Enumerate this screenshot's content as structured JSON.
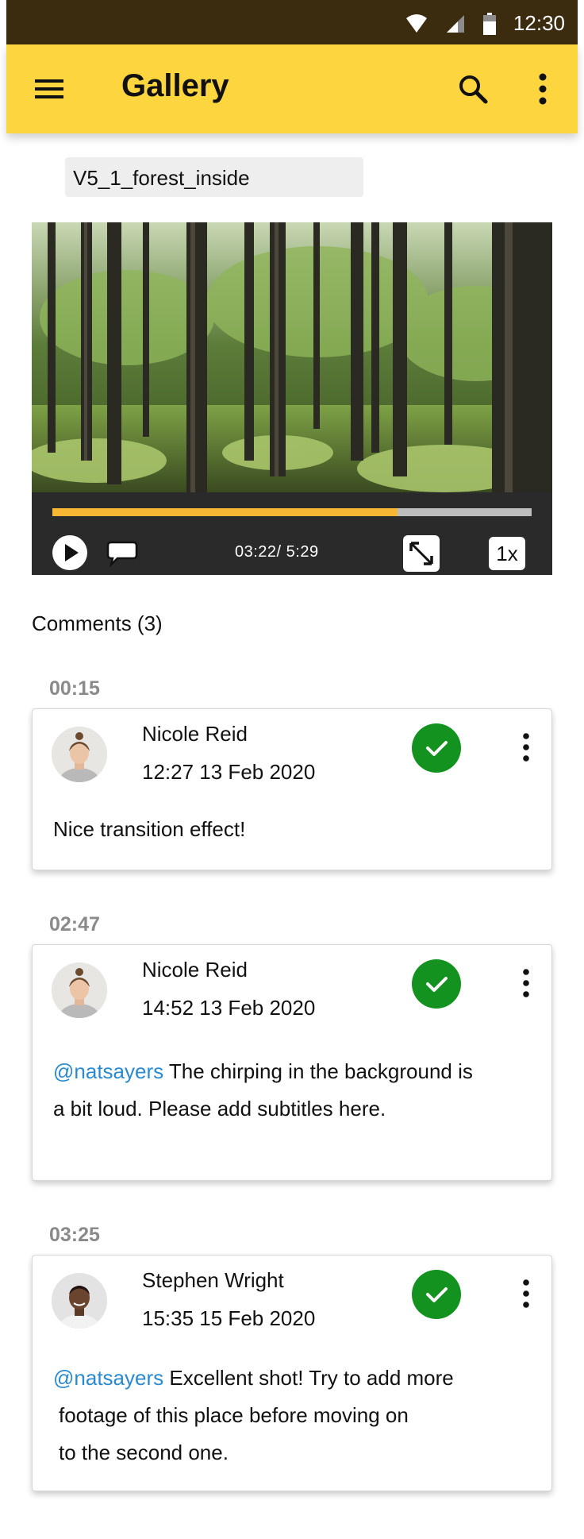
{
  "status_bar": {
    "time": "12:30"
  },
  "app_bar": {
    "title": "Gallery"
  },
  "video": {
    "filename": "V5_1_forest_inside",
    "progress": 0.72,
    "time_readout": "03:22/ 5:29",
    "speed": "1x"
  },
  "comments": {
    "heading": "Comments (3)",
    "items": [
      {
        "timestamp": "00:15",
        "author": "Nicole Reid",
        "date": "12:27 13 Feb 2020",
        "mention": "",
        "text": "Nice transition effect!",
        "resolved": true
      },
      {
        "timestamp": "02:47",
        "author": "Nicole Reid",
        "date": "14:52 13 Feb 2020",
        "mention": "@natsayers",
        "text_line1": " The chirping in the background is",
        "text_line2": "a bit loud. Please add subtitles here.",
        "resolved": true
      },
      {
        "timestamp": "03:25",
        "author": "Stephen Wright",
        "date": "15:35 15 Feb 2020",
        "mention": "@natsayers",
        "text_line1": " Excellent shot! Try to add more",
        "text_line2": "footage of this place before moving on",
        "text_line3": "to the second one.",
        "resolved": true
      }
    ]
  },
  "colors": {
    "app_bar": "#fdd53f",
    "status_bar": "#3b2b0f",
    "accent_progress": "#f7b733",
    "resolved": "#13921f",
    "mention": "#2a8ad1"
  },
  "icons": [
    "menu-icon",
    "search-icon",
    "more-vert-icon",
    "wifi-icon",
    "signal-icon",
    "battery-icon",
    "play-icon",
    "comment-icon",
    "fullscreen-icon",
    "check-icon"
  ]
}
